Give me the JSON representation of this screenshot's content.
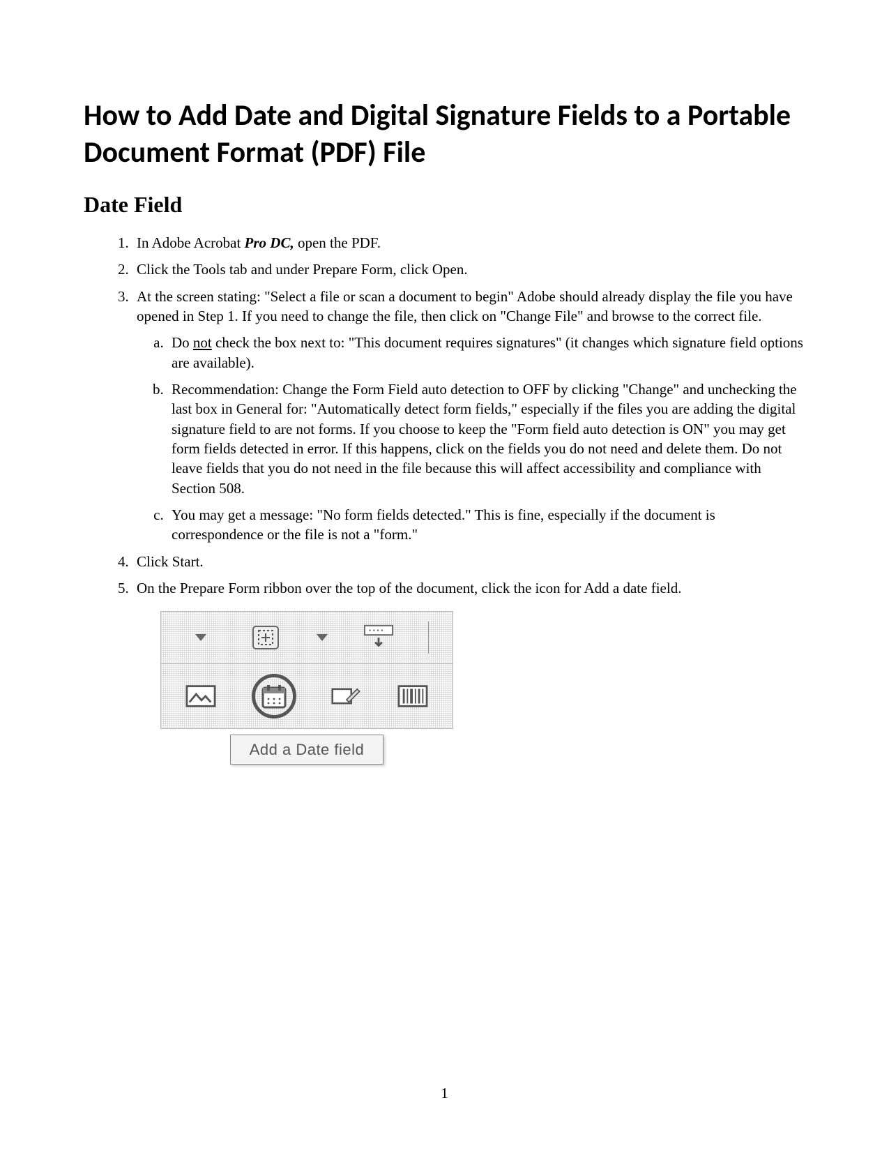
{
  "title": "How to Add Date and Digital Signature Fields to a Portable Document Format (PDF) File",
  "section_heading": "Date Field",
  "steps": {
    "s1_pre": "In Adobe Acrobat ",
    "s1_bold": "Pro DC,",
    "s1_post": " open the PDF.",
    "s2": "Click the Tools tab and under Prepare Form, click Open.",
    "s3": "At the screen stating: \"Select a file or scan a document to begin\" Adobe should already display the file you have opened in Step 1.  If you need to change the file, then click on \"Change File\" and browse to the correct file.",
    "s3a_pre": "Do ",
    "s3a_underline": "not",
    "s3a_post": " check the box next to: \"This document requires signatures\" (it changes which signature field options are available).",
    "s3b": "Recommendation:  Change the Form Field auto detection to OFF by clicking \"Change\" and unchecking the last box in General for: \"Automatically detect form fields,\" especially if the files you are adding the digital signature field to are not forms.  If you choose to keep the \"Form field auto detection is ON\" you may get form fields detected in error.  If this happens, click on the fields you do not need and delete them.  Do not leave fields that you do not need in the file because this will affect accessibility and compliance with Section 508.",
    "s3c": "You may get a message: \"No form fields detected.\"  This is fine, especially if the document is correspondence or the file is not a \"form.\"",
    "s4": "Click Start.",
    "s5": "On the Prepare Form ribbon over the top of the document, click the icon for Add a date field."
  },
  "tooltip": "Add a Date field",
  "page_number": "1"
}
